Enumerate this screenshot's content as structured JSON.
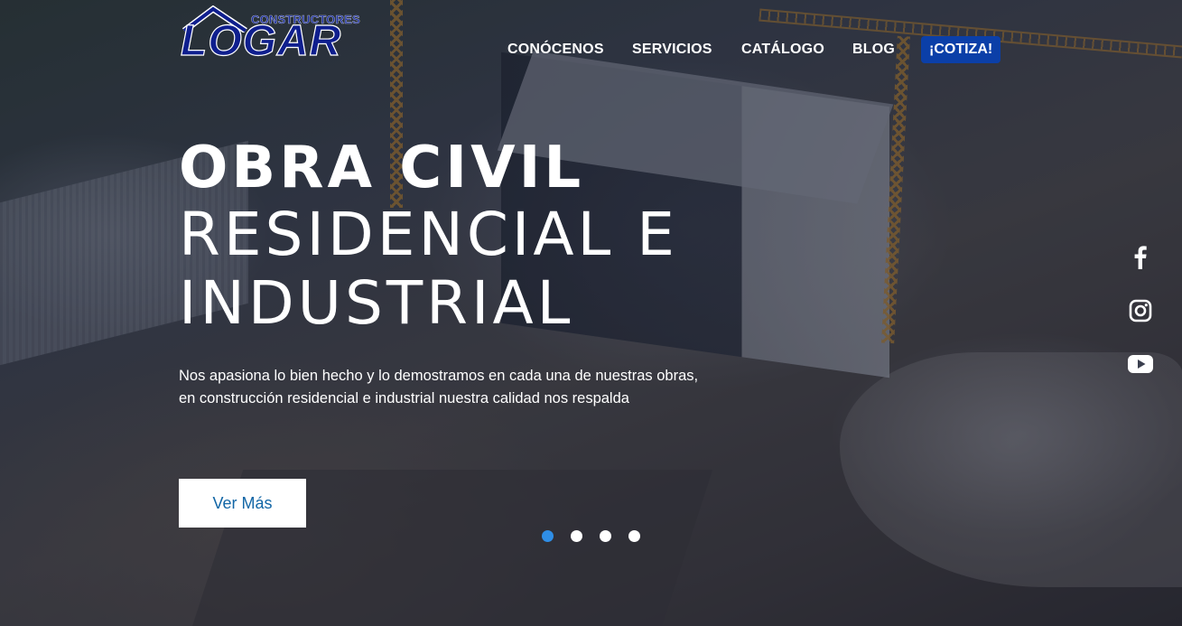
{
  "logo": {
    "subtitle": "CONSTRUCTORES",
    "name": "LOGAR"
  },
  "nav": {
    "items": [
      {
        "label": "CONÓCENOS"
      },
      {
        "label": "SERVICIOS"
      },
      {
        "label": "CATÁLOGO"
      },
      {
        "label": "BLOG"
      }
    ],
    "cta_label": "¡COTIZA!"
  },
  "hero": {
    "line1": "OBRA CIVIL",
    "line2": "RESIDENCIAL E",
    "line3": "INDUSTRIAL",
    "description_line1": "Nos apasiona lo bien hecho y lo demostramos en cada una de nuestras obras,",
    "description_line2": "en construcción residencial e industrial nuestra calidad nos respalda",
    "button_label": "Ver Más"
  },
  "carousel": {
    "slide_count": 4,
    "active_index": 0,
    "active_color": "#2f8ee6"
  },
  "social": {
    "icons": [
      "facebook-icon",
      "instagram-icon",
      "youtube-icon"
    ]
  },
  "colors": {
    "brand_blue": "#0f1f8e",
    "cta_blue": "#0b3fa8",
    "button_text": "#1266a6"
  }
}
